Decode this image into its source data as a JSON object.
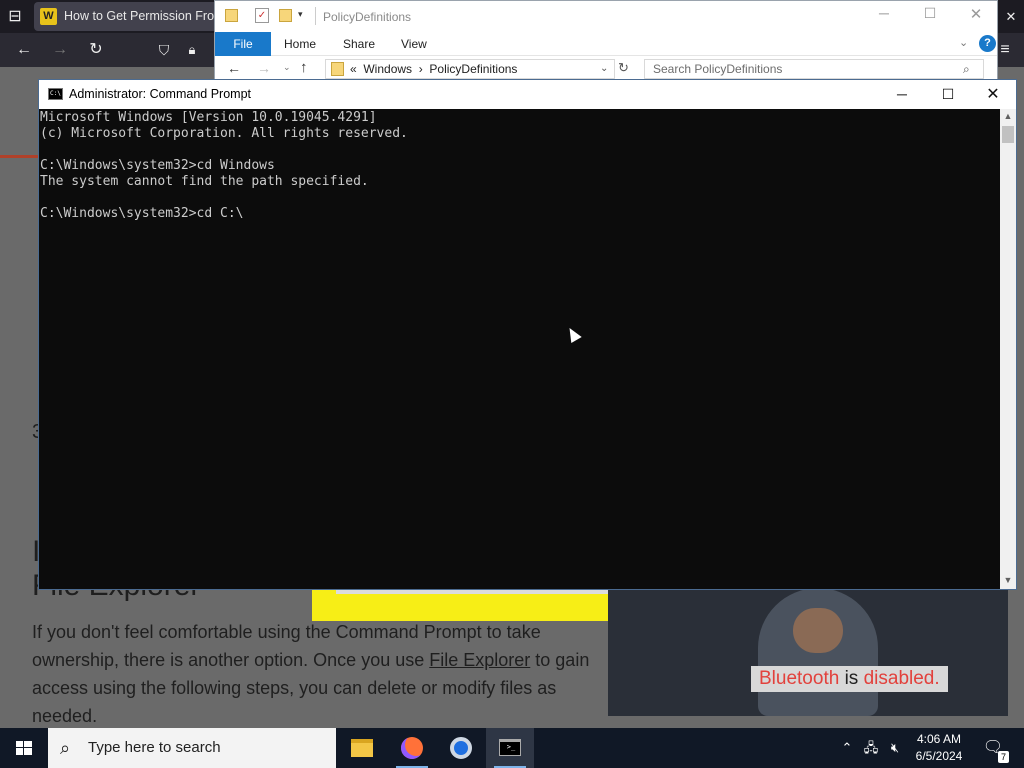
{
  "browser": {
    "tab_title": "How to Get Permission From",
    "article": {
      "heading_line1": "I",
      "heading_line2": "File Explorer",
      "step_number": "3",
      "para_part1": "If you don't feel comfortable using the Command Prompt to take ownership, there is another option. Once you use ",
      "link": "File Explorer",
      "para_part2": " to gain access using the following steps, you can delete or modify files as needed."
    },
    "video_caption": {
      "word1": "Bluetooth",
      "word2": "is",
      "word3": "disabled."
    }
  },
  "explorer": {
    "title": "PolicyDefinitions",
    "ribbon": {
      "file": "File",
      "home": "Home",
      "share": "Share",
      "view": "View"
    },
    "path": {
      "sep": "«",
      "part1": "Windows",
      "part2": "PolicyDefinitions"
    },
    "search_placeholder": "Search PolicyDefinitions"
  },
  "cmd": {
    "title": "Administrator: Command Prompt",
    "lines": [
      "Microsoft Windows [Version 10.0.19045.4291]",
      "(c) Microsoft Corporation. All rights reserved.",
      "",
      "C:\\Windows\\system32>cd Windows",
      "The system cannot find the path specified.",
      "",
      "C:\\Windows\\system32>cd C:\\"
    ]
  },
  "taskbar": {
    "search_placeholder": "Type here to search",
    "time": "4:06 AM",
    "date": "6/5/2024",
    "notifications": "7"
  },
  "colors": {
    "accent": "#1979ca",
    "video_caption_red": "#e2413c",
    "yellow_ad": "#f7ee16"
  }
}
